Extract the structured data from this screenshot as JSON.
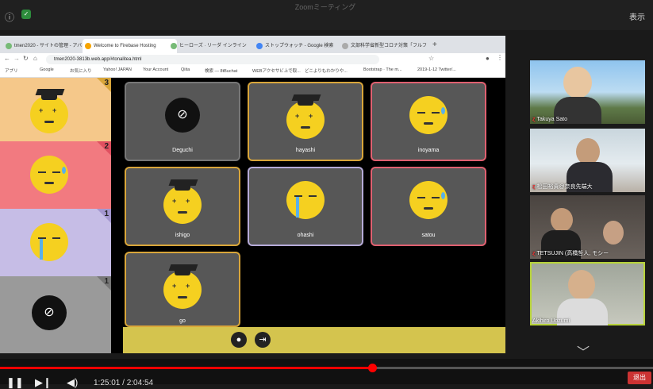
{
  "zoom_window": {
    "title": "Zoomミーティング",
    "view_label": "表示"
  },
  "browser": {
    "tabs": [
      {
        "label": "tmen2020 - サイトの管理 - アバ"
      },
      {
        "label": "Welcome to Firebase Hosting"
      },
      {
        "label": "ヒーローズ · リーダ インライン"
      },
      {
        "label": "ストップウォッチ - Google 検索"
      },
      {
        "label": "文部科学省新型コロナ対策「フルフ"
      }
    ],
    "url": "tmen2020-3813b.web.app/#tonalitea.html",
    "bookmarks": [
      {
        "label": "アプリ"
      },
      {
        "label": "Google"
      },
      {
        "label": "お気に入り"
      },
      {
        "label": "Yahoo! JAPAN"
      },
      {
        "label": "Your Account"
      },
      {
        "label": "Qiita"
      },
      {
        "label": "検索 — 8tBuchat"
      },
      {
        "label": "WEBアクセサビ上で取..."
      },
      {
        "label": "どこよりもわかりや..."
      },
      {
        "label": "Bootstrap · The m..."
      },
      {
        "label": "2019-1-12 Twitter/..."
      }
    ]
  },
  "board": {
    "rows": [
      {
        "rank": "3"
      },
      {
        "rank": "2"
      },
      {
        "rank": "1"
      },
      {
        "rank": "1"
      }
    ]
  },
  "tiles": [
    {
      "name": "Deguchi"
    },
    {
      "name": "hayashi"
    },
    {
      "name": "inoyama"
    },
    {
      "name": "ishigo"
    },
    {
      "name": "ohashi"
    },
    {
      "name": "satou"
    },
    {
      "name": "go"
    }
  ],
  "participants": [
    {
      "name": "Takuya Sato"
    },
    {
      "name": "松田裕貴@奈良先端大"
    },
    {
      "name": "TETSUJIN (高橋哲人, モシー"
    },
    {
      "name": "Akihiro Uozumi"
    }
  ],
  "player": {
    "timecode": "1:25:01 / 2:04:54",
    "progress": 0.57,
    "end_label": "退出"
  },
  "colors": {
    "gold": "#d9a63a",
    "pink": "#e06070",
    "lavender": "#b6abd8",
    "footer": "#d4c44e",
    "progress": "#ff0000"
  }
}
